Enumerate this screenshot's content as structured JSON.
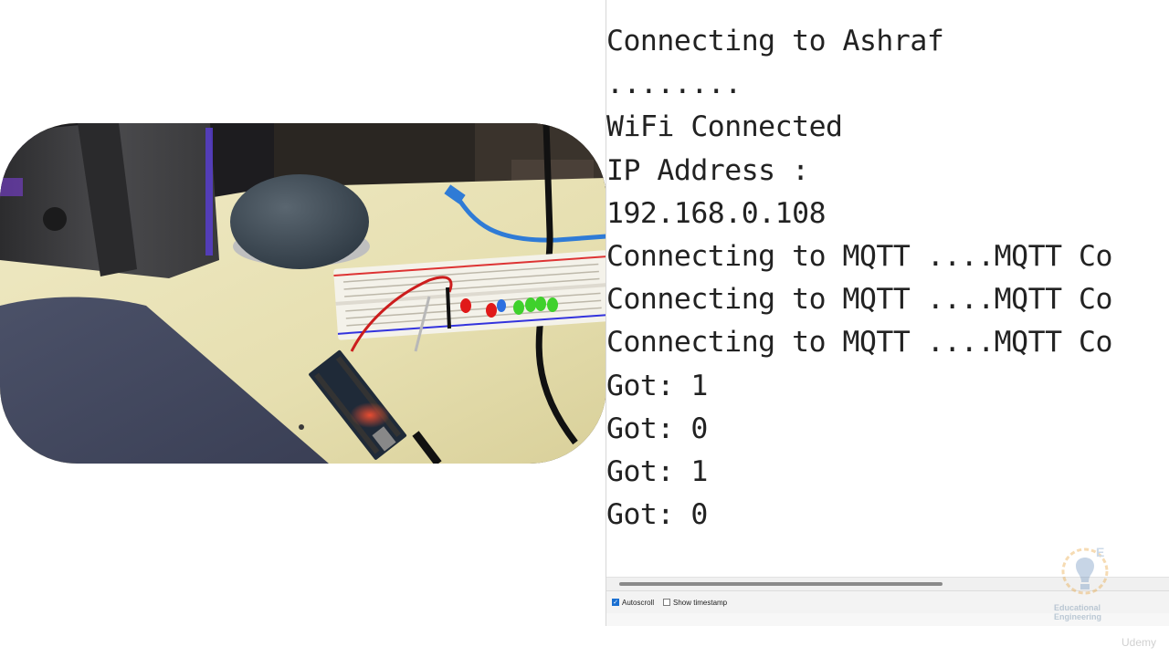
{
  "serial_monitor": {
    "lines": [
      "Connecting to Ashraf",
      "........",
      "WiFi Connected",
      "IP Address :",
      "192.168.0.108",
      "Connecting to MQTT ....MQTT Co",
      "Connecting to MQTT ....MQTT Co",
      "Connecting to MQTT ....MQTT Co",
      "Got: 1",
      "Got: 0",
      "Got: 1",
      "Got: 0"
    ],
    "autoscroll": {
      "label": "Autoscroll",
      "checked": true
    },
    "timestamp": {
      "label": "Show timestamp",
      "checked": false
    }
  },
  "watermarks": {
    "logo_line1": "Educational",
    "logo_line2": "Engineering",
    "platform": "Udemy"
  },
  "colors": {
    "checkbox_accent": "#1a6fd1",
    "monitor_text": "#222222",
    "led_red": "#e01919",
    "led_green": "#3fd12c",
    "led_blue": "#2c6fe0",
    "desk": "#e7e2b8"
  },
  "icons": {
    "check": "check-icon",
    "logo": "educational-engineering-logo-icon"
  }
}
